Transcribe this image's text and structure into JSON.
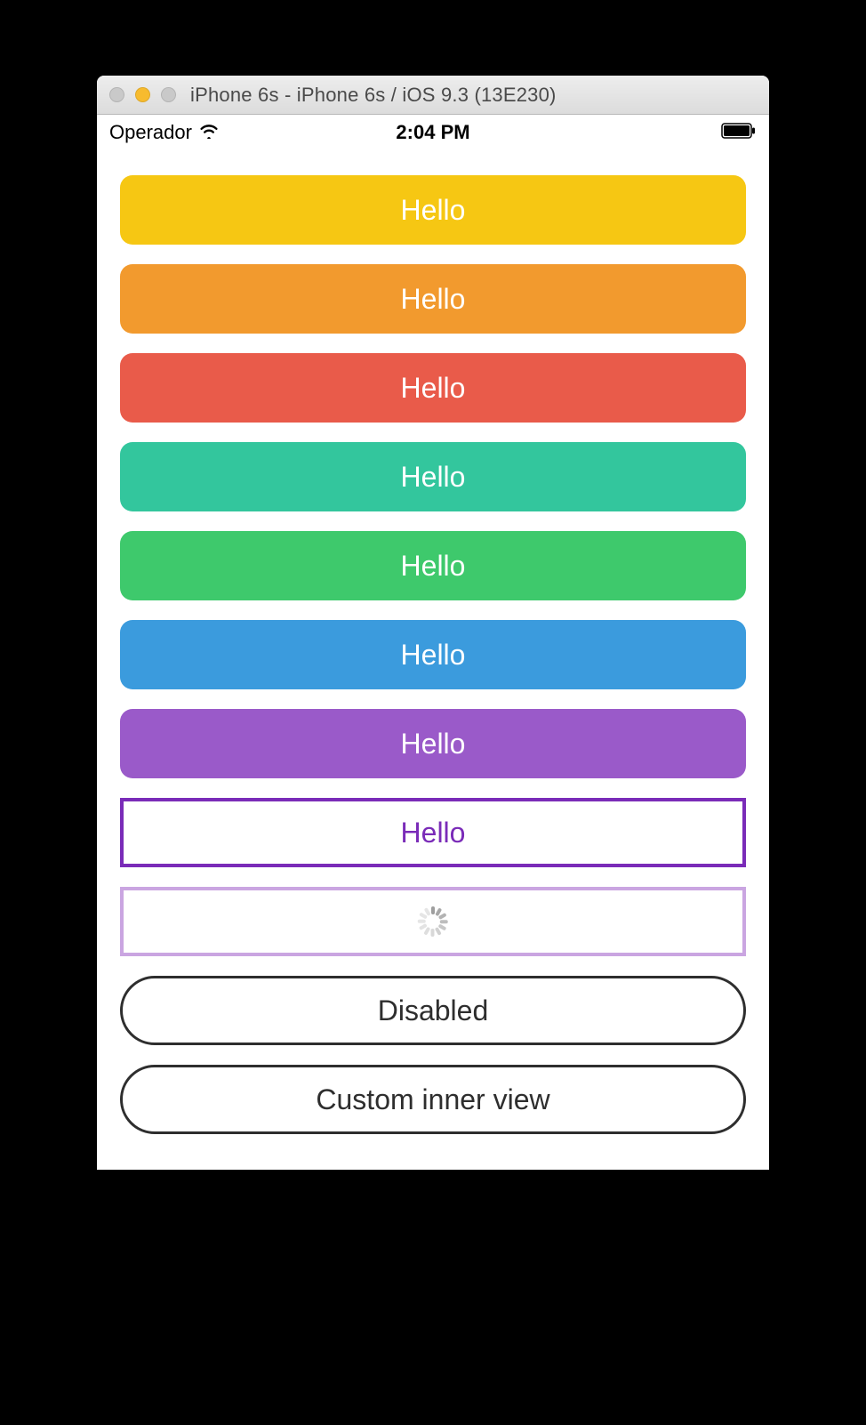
{
  "window": {
    "title": "iPhone 6s - iPhone 6s / iOS 9.3 (13E230)"
  },
  "statusBar": {
    "carrier": "Operador",
    "time": "2:04 PM"
  },
  "buttons": [
    {
      "label": "Hello",
      "bg": "#f6c713",
      "kind": "filled"
    },
    {
      "label": "Hello",
      "bg": "#f29a2e",
      "kind": "filled"
    },
    {
      "label": "Hello",
      "bg": "#e95b4a",
      "kind": "filled"
    },
    {
      "label": "Hello",
      "bg": "#33c69d",
      "kind": "filled"
    },
    {
      "label": "Hello",
      "bg": "#3ec96c",
      "kind": "filled"
    },
    {
      "label": "Hello",
      "bg": "#3b9bdd",
      "kind": "filled"
    },
    {
      "label": "Hello",
      "bg": "#9a5ac9",
      "kind": "filled"
    },
    {
      "label": "Hello",
      "border": "#7a2bb8",
      "text": "#7a2bb8",
      "kind": "outlined"
    },
    {
      "label": "",
      "border": "#caa5e1",
      "kind": "loading"
    },
    {
      "label": "Disabled",
      "kind": "pill"
    },
    {
      "label": "Custom inner view",
      "kind": "pill"
    }
  ]
}
